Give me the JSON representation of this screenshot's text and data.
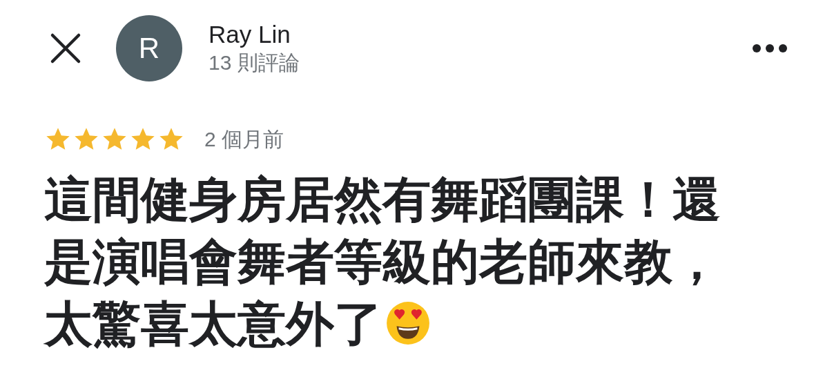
{
  "reviewer": {
    "avatar_letter": "R",
    "name": "Ray Lin",
    "review_count": "13 則評論"
  },
  "review": {
    "stars": 5,
    "time": "2 個月前",
    "text_lines": [
      "這間健身房居然有舞蹈團課！還",
      "是演唱會舞者等級的老師來教，",
      "太驚喜太意外了"
    ]
  }
}
